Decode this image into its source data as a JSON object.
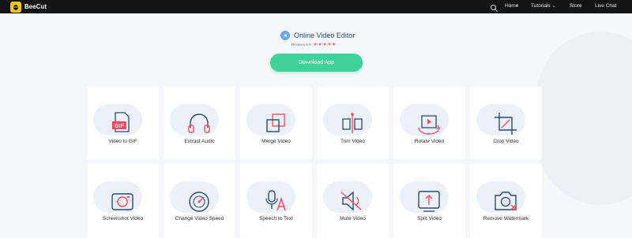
{
  "app": {
    "logo_text": "BeeCut"
  },
  "nav": {
    "search_icon": "search-icon",
    "home": "Home",
    "tutorials": "Tutorials",
    "store": "Store",
    "live_chat": "Live Chat"
  },
  "hero": {
    "title": "Online Video Editor",
    "review_label": "Reviews 5.0",
    "stars": "★★★★★",
    "download_label": "Download App"
  },
  "tools": [
    {
      "label": "Video to GIF",
      "icon": "video-to-gif-icon"
    },
    {
      "label": "Extract Audio",
      "icon": "headphones-icon"
    },
    {
      "label": "Merge Video",
      "icon": "merge-icon"
    },
    {
      "label": "Trim Video",
      "icon": "trim-icon"
    },
    {
      "label": "Rotate Video",
      "icon": "rotate-icon"
    },
    {
      "label": "Crop Video",
      "icon": "crop-icon"
    },
    {
      "label": "Screenshot Video",
      "icon": "camera-icon"
    },
    {
      "label": "Change Video Speed",
      "icon": "speed-icon"
    },
    {
      "label": "Speech to Text",
      "icon": "microphone-icon"
    },
    {
      "label": "Mute Video",
      "icon": "mute-icon"
    },
    {
      "label": "Split Video",
      "icon": "split-icon"
    },
    {
      "label": "Remove Watermark",
      "icon": "remove-watermark-icon"
    }
  ],
  "colors": {
    "topbar": "#141414",
    "accent_green": "#3fd19a",
    "icon_blue": "#2b4a6f",
    "icon_red": "#ff4b5c",
    "star": "#ff5a6a"
  }
}
